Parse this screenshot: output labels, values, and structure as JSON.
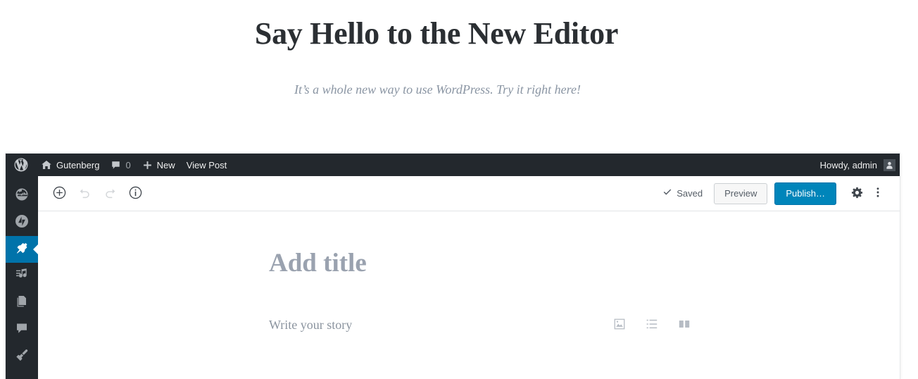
{
  "hero": {
    "title": "Say Hello to the New Editor",
    "subtitle": "It’s a whole new way to use WordPress. Try it right here!"
  },
  "admin_bar": {
    "logo_icon": "wordpress-logo-icon",
    "site_icon": "home-icon",
    "site_name": "Gutenberg",
    "comments_icon": "comment-bubble-icon",
    "comments_count": "0",
    "new_icon": "plus-icon",
    "new_label": "New",
    "view_post_label": "View Post",
    "howdy_label": "Howdy, admin",
    "avatar_icon": "user-avatar-icon"
  },
  "sidebar": {
    "items": [
      {
        "name": "dashboard",
        "icon": "dashboard-icon",
        "current": false
      },
      {
        "name": "jetpack",
        "icon": "jetpack-icon",
        "current": false
      },
      {
        "name": "posts",
        "icon": "pin-icon",
        "current": true
      },
      {
        "name": "media",
        "icon": "media-icon",
        "current": false
      },
      {
        "name": "pages",
        "icon": "pages-icon",
        "current": false
      },
      {
        "name": "comments",
        "icon": "comment-icon",
        "current": false
      },
      {
        "name": "appearance",
        "icon": "paintbrush-icon",
        "current": false
      }
    ]
  },
  "editor_toolbar": {
    "inserter_icon": "plus-circle-icon",
    "undo_icon": "undo-arrow-icon",
    "redo_icon": "redo-arrow-icon",
    "info_icon": "info-circle-icon",
    "saved_icon": "checkmark-icon",
    "saved_label": "Saved",
    "preview_label": "Preview",
    "publish_label": "Publish…",
    "settings_icon": "gear-icon",
    "more_icon": "vertical-ellipsis-icon"
  },
  "post": {
    "title_placeholder": "Add title",
    "body_placeholder": "Write your story",
    "shortcuts": [
      {
        "name": "image-block",
        "icon": "image-icon"
      },
      {
        "name": "list-block",
        "icon": "bulleted-list-icon"
      },
      {
        "name": "columns-block",
        "icon": "columns-icon"
      }
    ]
  },
  "colors": {
    "admin_dark": "#23282d",
    "accent_blue": "#0085ba",
    "current_menu_blue": "#0073aa",
    "placeholder_gray": "#9aa2af"
  }
}
